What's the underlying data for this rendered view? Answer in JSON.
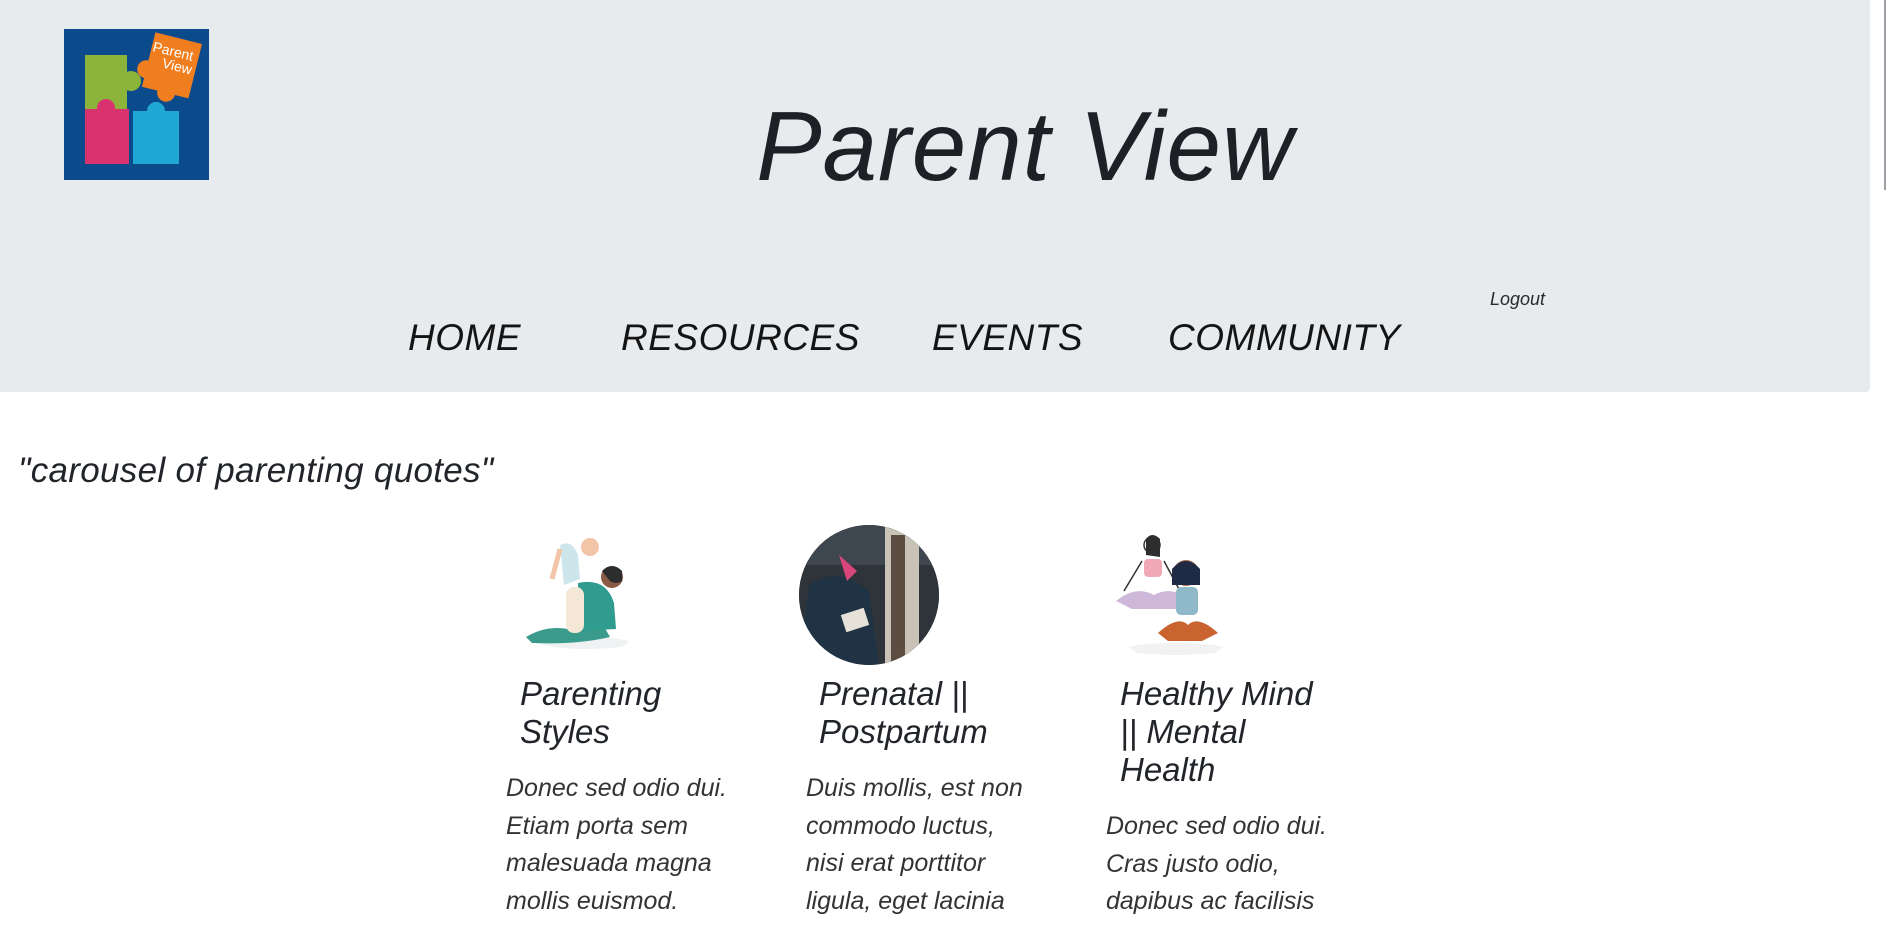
{
  "logo": {
    "line1": "Parent",
    "line2": "View"
  },
  "header": {
    "title": "Parent View"
  },
  "nav": {
    "items": [
      {
        "label": "HOME"
      },
      {
        "label": "RESOURCES"
      },
      {
        "label": "EVENTS"
      },
      {
        "label": "COMMUNITY"
      }
    ],
    "logout": "Logout"
  },
  "main": {
    "carousel_text": "\"carousel of parenting quotes\"",
    "cards": [
      {
        "title_line1": "Parenting",
        "title_line2": "Styles",
        "title_line3": "",
        "body": [
          "Donec sed odio dui.",
          "Etiam porta sem",
          "malesuada magna",
          "mollis euismod."
        ],
        "image_icon": "parent-lifting-baby-illustration"
      },
      {
        "title_line1": "Prenatal ||",
        "title_line2": "Postpartum",
        "title_line3": "",
        "body": [
          "Duis mollis, est non",
          "commodo luctus,",
          "nisi erat porttitor",
          "ligula, eget lacinia"
        ],
        "image_icon": "parent-reading-photo"
      },
      {
        "title_line1": "Healthy Mind",
        "title_line2": "|| Mental",
        "title_line3": "Health",
        "body": [
          "Donec sed odio dui.",
          "Cras justo odio,",
          "dapibus ac facilisis"
        ],
        "image_icon": "meditation-illustration"
      }
    ]
  },
  "colors": {
    "header_bg": "#e8ebee",
    "logo_bg": "#0b4a8b",
    "puzzle_green": "#8cb43a",
    "puzzle_orange": "#f07e1f",
    "puzzle_pink": "#d8336e",
    "puzzle_blue": "#1fa8d4",
    "text": "#212529"
  }
}
